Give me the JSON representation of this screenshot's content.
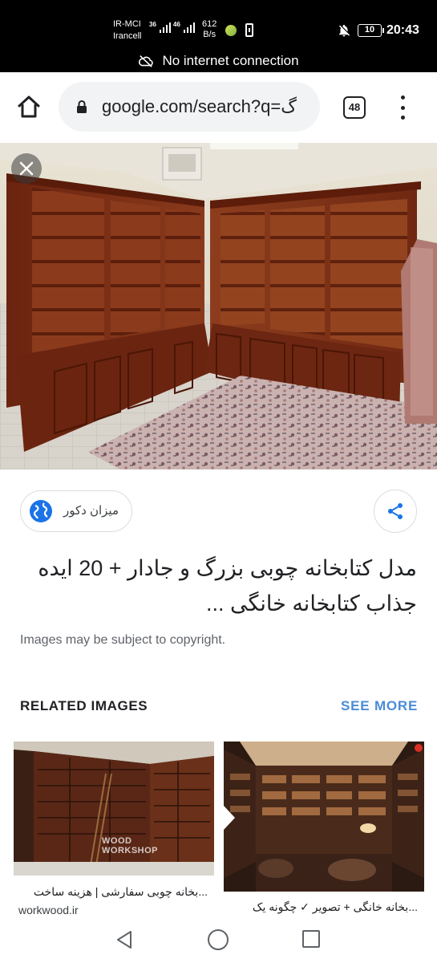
{
  "status_bar": {
    "carrier_line1": "IR-MCI",
    "carrier_line2": "Irancell",
    "signal1_type": "3G",
    "signal2_type": "4G",
    "net_speed_value": "612",
    "net_speed_unit": "B/s",
    "battery_level": "10",
    "time": "20:43"
  },
  "network_banner": {
    "text": "No internet connection",
    "icon": "cloud-off-icon"
  },
  "browser": {
    "url": "google.com/search?q=گ",
    "tab_count": "48",
    "home_icon": "home-icon",
    "menu_icon": "more-vert-icon"
  },
  "viewer": {
    "close_icon": "close-icon",
    "source_name": "میزان دکور",
    "source_icon": "globe-icon",
    "share_icon": "share-icon",
    "title": "مدل کتابخانه چوبی بزرگ و جادار + 20 ایده جذاب کتابخانه خانگی ...",
    "copyright_notice": "Images may be subject to copyright."
  },
  "related": {
    "heading": "RELATED IMAGES",
    "see_more": "SEE MORE",
    "items": [
      {
        "caption": "...بخانه چوبی سفارشی | هزینه ساخت",
        "domain": "workwood.ir",
        "watermark_line1": "WOOD",
        "watermark_line2": "WORKSHOP"
      },
      {
        "caption": "...بخانه خانگی + تصویر ✓ چگونه یک",
        "domain": ""
      }
    ]
  },
  "nav_bar": {
    "back_icon": "back-icon",
    "home_icon": "home-circle-icon",
    "recents_icon": "recents-icon"
  },
  "colors": {
    "accent_blue": "#4a8cd8",
    "status_bg": "#000000",
    "wood": "#7a2e16"
  }
}
